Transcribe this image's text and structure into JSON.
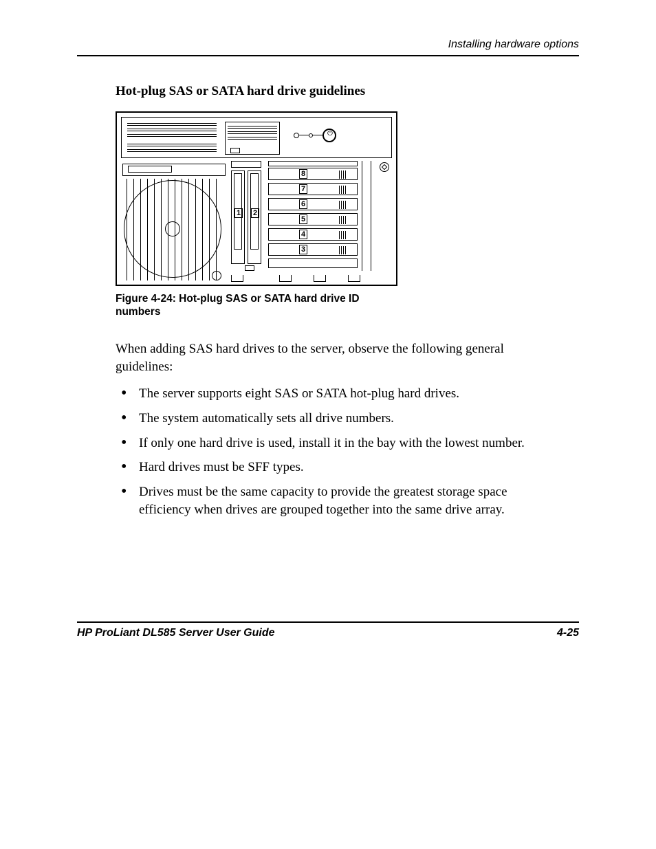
{
  "header": {
    "section": "Installing hardware options"
  },
  "heading": "Hot-plug SAS or SATA hard drive guidelines",
  "figure": {
    "caption": "Figure 4-24:  Hot-plug SAS or SATA hard drive ID numbers",
    "bay_labels_vertical": [
      "1",
      "2"
    ],
    "drive_labels": [
      "8",
      "7",
      "6",
      "5",
      "4",
      "3"
    ]
  },
  "intro": "When adding SAS hard drives to the server, observe the following general guidelines:",
  "bullets": [
    "The server supports eight SAS or SATA hot-plug hard drives.",
    "The system automatically sets all drive numbers.",
    "If only one hard drive is used, install it in the bay with the lowest number.",
    "Hard drives must be SFF types.",
    "Drives must be the same capacity to provide the greatest storage space efficiency when drives are grouped together into the same drive array."
  ],
  "footer": {
    "title": "HP ProLiant DL585 Server User Guide",
    "page": "4-25"
  }
}
